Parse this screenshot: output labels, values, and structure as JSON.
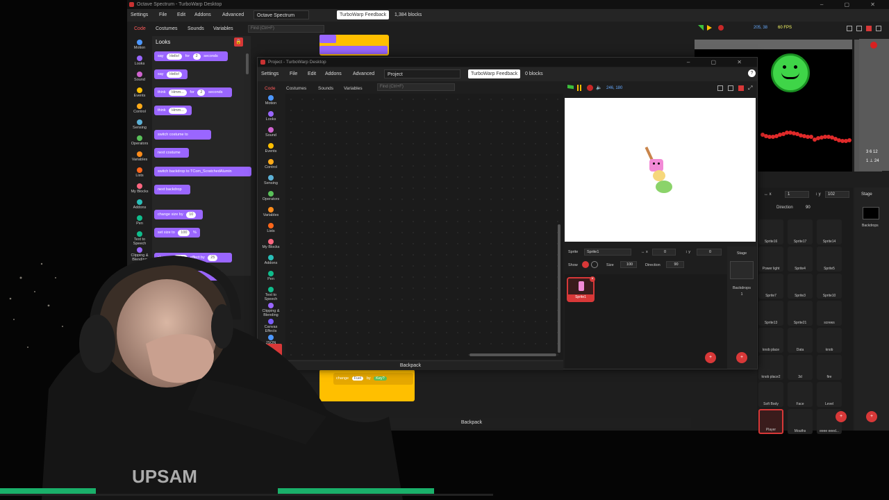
{
  "bg_window": {
    "title": "Octave Spectrum - TurboWarp Desktop",
    "menu": {
      "settings": "Settings",
      "file": "File",
      "edit": "Edit",
      "addons": "Addons",
      "advanced": "Advanced",
      "project": "Octave Spectrum",
      "feedback": "TurboWarp Feedback",
      "blocks": "1,384 blocks"
    },
    "tabs": {
      "code": "Code",
      "costumes": "Costumes",
      "sounds": "Sounds",
      "variables": "Variables"
    },
    "find_placeholder": "Find (Ctrl+F)",
    "stage_readout": "205, 38",
    "fps": "60 FPS",
    "pos_x": "1",
    "pos_y": "102",
    "direction": "90",
    "backpack": "Backpack"
  },
  "categories": [
    "Motion",
    "Looks",
    "Sound",
    "Events",
    "Control",
    "Sensing",
    "Operators",
    "Variables",
    "Lists",
    "My Blocks",
    "Addons",
    "Pen",
    "Text to Speech",
    "Clipping & Blending",
    "Canvas Effects",
    "JSON"
  ],
  "category_colors": [
    "#4c97ff",
    "#9966ff",
    "#cf63cf",
    "#ffbf00",
    "#ffab19",
    "#5cb1d6",
    "#59c059",
    "#ff8c1a",
    "#ff661a",
    "#ff6680",
    "#29beb8",
    "#0fbd8c",
    "#0fbd8c",
    "#9966ff",
    "#7a5cff",
    "#4c97ff"
  ],
  "palette": {
    "title": "Looks",
    "blocks": [
      {
        "pre": "say",
        "arg": "Hello!",
        "mid": "for",
        "arg2": "2",
        "post": "seconds"
      },
      {
        "pre": "say",
        "arg": "Hello!",
        "mid": "",
        "arg2": "",
        "post": ""
      },
      {
        "pre": "think",
        "arg": "Hmm...",
        "mid": "for",
        "arg2": "2",
        "post": "seconds"
      },
      {
        "pre": "think",
        "arg": "Hmm...",
        "mid": "",
        "arg2": "",
        "post": ""
      },
      {
        "pre": "switch costume to",
        "arg": "",
        "mid": "",
        "arg2": "",
        "post": ""
      },
      {
        "pre": "next costume",
        "arg": "",
        "mid": "",
        "arg2": "",
        "post": ""
      },
      {
        "pre": "switch backdrop to",
        "arg": "",
        "mid": "TCom_ScratchedAlumin",
        "arg2": "",
        "post": ""
      },
      {
        "pre": "next backdrop",
        "arg": "",
        "mid": "",
        "arg2": "",
        "post": ""
      },
      {
        "pre": "change size by",
        "arg": "10",
        "mid": "",
        "arg2": "",
        "post": ""
      },
      {
        "pre": "set size to",
        "arg": "100",
        "mid": "",
        "arg2": "",
        "post": "%"
      },
      {
        "pre": "change",
        "arg": "color",
        "mid": "effect by",
        "arg2": "25",
        "post": ""
      },
      {
        "pre": "set",
        "arg": "",
        "mid": "effect to",
        "arg2": "0",
        "post": ""
      }
    ]
  },
  "fg_window": {
    "title": "Project - TurboWarp Desktop",
    "menu": {
      "settings": "Settings",
      "file": "File",
      "edit": "Edit",
      "addons": "Addons",
      "advanced": "Advanced",
      "project": "Project",
      "feedback": "TurboWarp Feedback",
      "blocks": "0 blocks"
    },
    "tabs": {
      "code": "Code",
      "costumes": "Costumes",
      "sounds": "Sounds",
      "variables": "Variables"
    },
    "find_placeholder": "Find (Ctrl+F)",
    "stage_readout": "246, 180",
    "sprite_label": "Sprite",
    "sprite_name": "Sprite1",
    "x_value": "0",
    "y_value": "0",
    "show_label": "Show",
    "size_label": "Size",
    "size_value": "100",
    "direction_label": "Direction",
    "direction_value": "90",
    "sprite_tile": "Sprite1",
    "stage_label": "Stage",
    "backdrops_label": "Backdrops",
    "backdrops_count": "1",
    "backpack": "Backpack"
  },
  "bg_sprites": [
    "Sprite16",
    "Sprite17",
    "Sprite14",
    "Power light",
    "Sprite4",
    "Sprite5",
    "Sprite7",
    "Sprite3",
    "Sprite10",
    "Sprite13",
    "Sprite21",
    "screws",
    "knob place",
    "Data",
    "knob",
    "knob place2",
    "3d",
    "fire",
    "Soft Body",
    "Face",
    "Level",
    "Player",
    "Mouths",
    "eeee eeed..."
  ],
  "bottom_script": {
    "text": "change",
    "arg": "Fuel",
    "mid": "by",
    "arg2": "Key?"
  }
}
